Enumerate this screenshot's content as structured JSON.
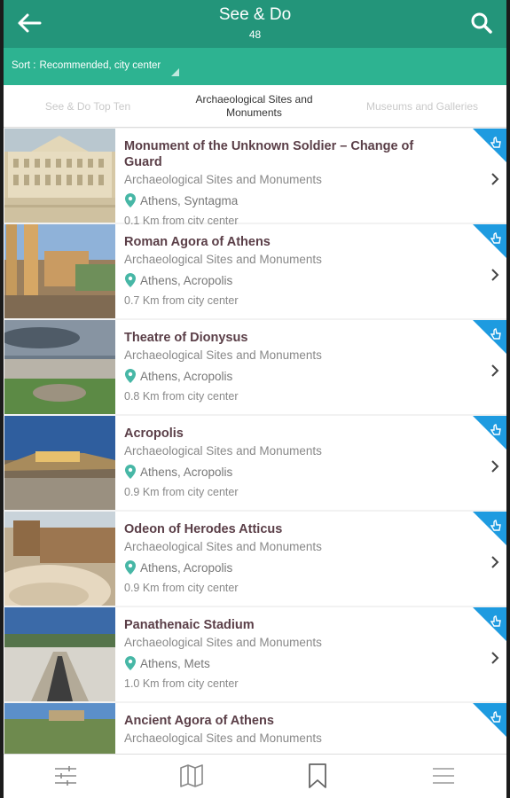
{
  "header": {
    "title": "See & Do",
    "count": "48",
    "back_icon": "arrow-left-icon",
    "search_icon": "search-icon"
  },
  "sort": {
    "label": "Sort :",
    "value": "Recommended, city center"
  },
  "tabs": [
    {
      "label": "See & Do Top Ten"
    },
    {
      "label": "Archaeological Sites and Monuments"
    },
    {
      "label": "Museums and Galleries"
    }
  ],
  "items": [
    {
      "name": "Monument of the Unknown Soldier – Change of Guard",
      "category": "Archaeological Sites and Monuments",
      "location": "Athens, Syntagma",
      "distance": "0.1 Km from city center"
    },
    {
      "name": "Roman Agora of Athens",
      "category": "Archaeological Sites and Monuments",
      "location": "Athens, Acropolis",
      "distance": "0.7 Km from city center"
    },
    {
      "name": "Theatre of Dionysus",
      "category": "Archaeological Sites and Monuments",
      "location": "Athens, Acropolis",
      "distance": "0.8 Km from city center"
    },
    {
      "name": "Acropolis",
      "category": "Archaeological Sites and Monuments",
      "location": "Athens, Acropolis",
      "distance": "0.9 Km from city center"
    },
    {
      "name": "Odeon of Herodes Atticus",
      "category": "Archaeological Sites and Monuments",
      "location": "Athens, Acropolis",
      "distance": "0.9 Km from city center"
    },
    {
      "name": "Panathenaic Stadium",
      "category": "Archaeological Sites and Monuments",
      "location": "Athens, Mets",
      "distance": "1.0 Km from city center"
    },
    {
      "name": "Ancient Agora of Athens",
      "category": "Archaeological Sites and Monuments"
    }
  ],
  "bottom_nav": [
    "filter-icon",
    "map-icon",
    "bookmark-icon",
    "menu-icon"
  ],
  "colors": {
    "appbar": "#23957a",
    "sortbar": "#2db391",
    "accent": "#1e9be0",
    "pin": "#47b7a6"
  }
}
